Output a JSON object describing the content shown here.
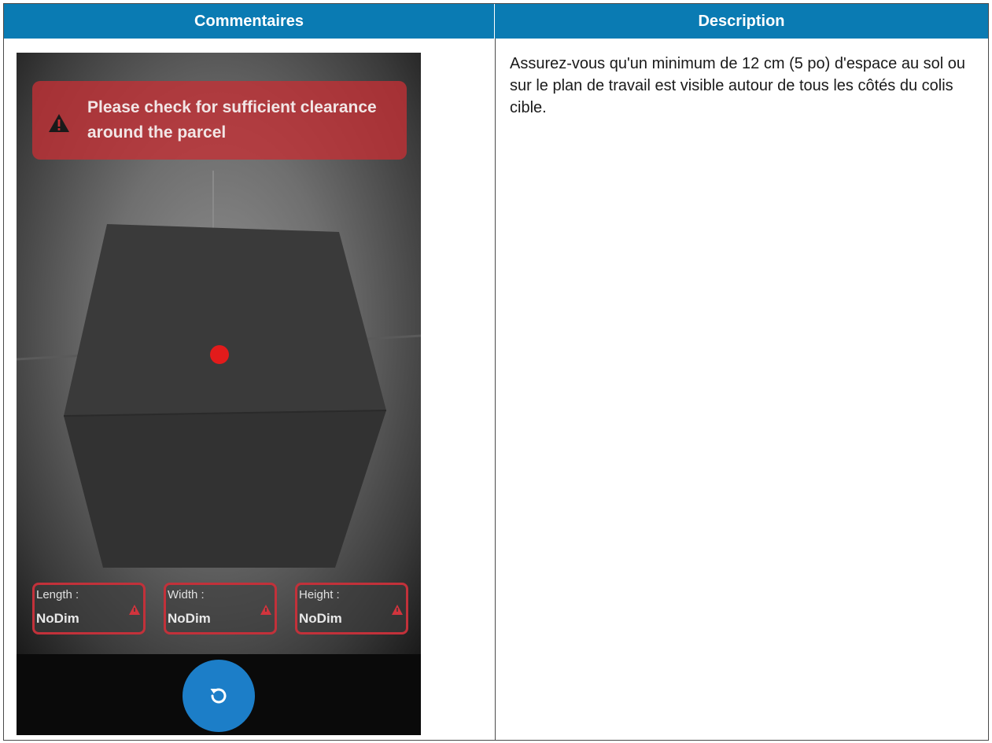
{
  "table": {
    "header_left": "Commentaires",
    "header_right": "Description"
  },
  "phone": {
    "banner_text": "Please check for sufficient clearance around the parcel",
    "dimensions": [
      {
        "label": "Length :",
        "value": "NoDim"
      },
      {
        "label": "Width :",
        "value": "NoDim"
      },
      {
        "label": "Height :",
        "value": "NoDim"
      }
    ],
    "accent_color": "#1c7ec8",
    "warning_color": "#c2313a"
  },
  "description": "Assurez-vous qu'un minimum de 12 cm (5 po) d'espace au sol ou sur le plan de travail est visible autour de tous les côtés du colis cible."
}
